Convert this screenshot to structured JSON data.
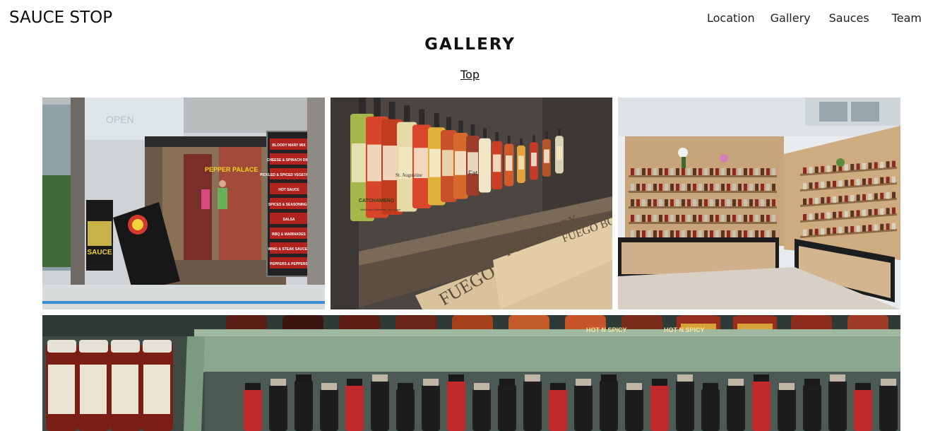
{
  "header": {
    "brand": "SAUCE STOP",
    "nav": [
      "Location",
      "Gallery",
      "Sauces",
      "Team"
    ]
  },
  "gallery": {
    "title": "GALLERY",
    "top_link": "Top"
  },
  "photos": {
    "storefront": {
      "sign_lines": [
        "BLOODY MARY MIX",
        "CHEESE & SPINACH DIPS",
        "PICKLED & SPICED VEGETABLES",
        "HOT SAUCE",
        "SPICES & SEASONINGS",
        "SALSA",
        "BBQ & MARINADES",
        "WING & STEAK SAUCES",
        "PEPPERS & PEPPERS"
      ],
      "store_name": "PEPPER PALACE",
      "open_sign": "OPEN",
      "left_sign": "SAUCE"
    },
    "shelf_labels": [
      "FUEGO BOX",
      "FUEGO",
      "FUEGO BOX"
    ],
    "bottle_labels": [
      "CATCHAMENO",
      "Match and Habanero Hot Sauce",
      "St. Augustine",
      "Fat"
    ],
    "jar_labels": [
      "HOT N SPICY",
      "HOT N SPICY"
    ]
  }
}
